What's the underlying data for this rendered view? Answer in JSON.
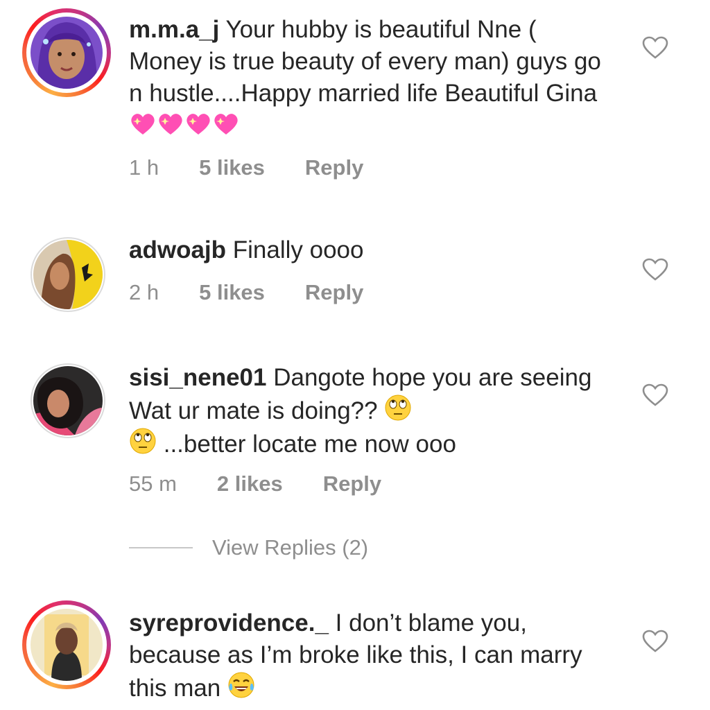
{
  "comments": [
    {
      "username": "m.m.a_j",
      "text": "Your hubby is beautiful Nne ( Money is true beauty of every man) guys go n hustle....Happy married life Beautiful Gina",
      "emoji": "sparkling-heart x4",
      "time": "1 h",
      "likes": "5 likes",
      "reply": "Reply",
      "has_story_ring": true
    },
    {
      "username": "adwoajb",
      "text": "Finally oooo",
      "time": "2 h",
      "likes": "5 likes",
      "reply": "Reply",
      "has_story_ring": false
    },
    {
      "username": "sisi_nene01",
      "text_a": "Dangote hope you are seeing Wat ur mate is doing??",
      "text_b": "...better locate me now ooo",
      "emoji": "face-with-rolling-eyes",
      "time": "55 m",
      "likes": "2 likes",
      "reply": "Reply",
      "has_story_ring": false,
      "view_replies": "View Replies (2)"
    },
    {
      "username": "syreprovidence._",
      "text": "I don’t blame you, because as I’m broke like this, I can marry this man",
      "emoji": "face-with-tears-of-joy",
      "has_story_ring": true
    }
  ],
  "icons": {
    "like": "heart-outline-icon"
  },
  "colors": {
    "meta_text": "#8e8e8e",
    "body_text": "#262626",
    "heart_stroke": "#8e8e8e"
  }
}
